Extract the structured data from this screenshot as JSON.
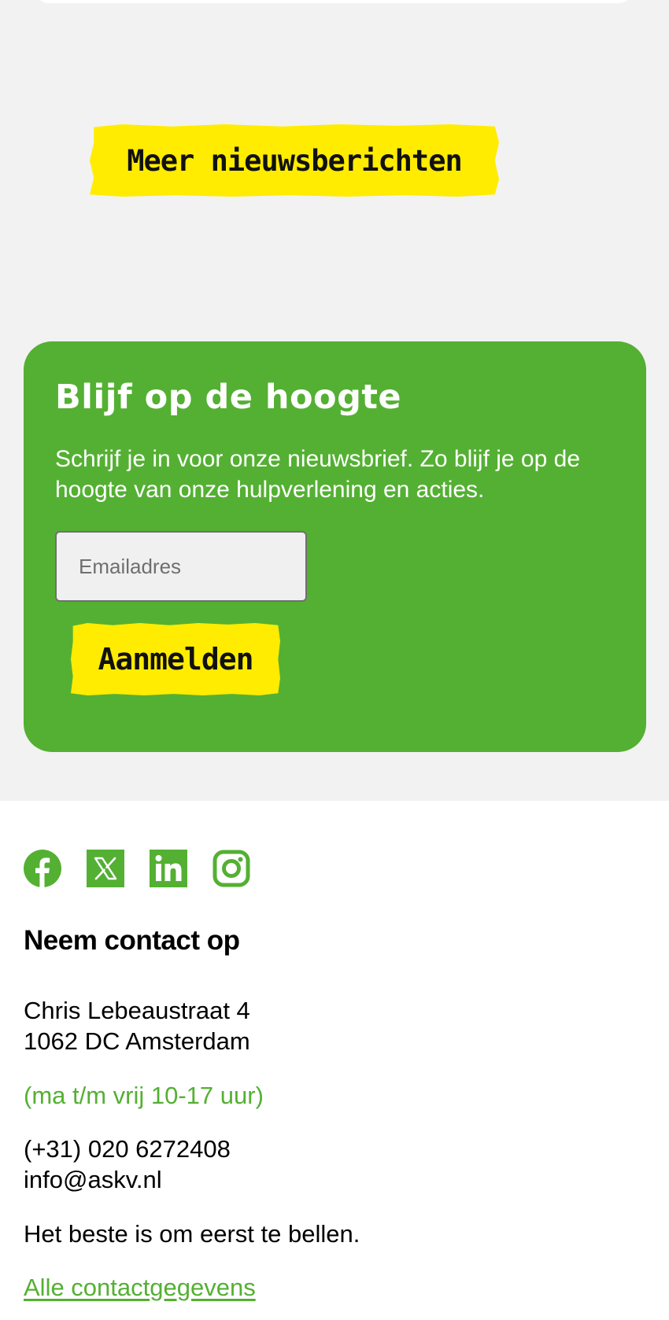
{
  "news": {
    "more_label": "Meer nieuwsberichten"
  },
  "newsletter": {
    "title": "Blijf op de hoogte",
    "text": "Schrijf je in voor onze nieuwsbrief. Zo blijf je op de hoogte van onze hulpverlening en acties.",
    "email_placeholder": "Emailadres",
    "email_value": "",
    "submit_label": "Aanmelden"
  },
  "footer": {
    "social_icons": [
      "facebook-icon",
      "x-icon",
      "linkedin-icon",
      "instagram-icon"
    ],
    "contact_title": "Neem contact op",
    "address_line1": "Chris Lebeaustraat 4",
    "address_line2": "1062 DC Amsterdam",
    "hours": "(ma t/m vrij 10-17 uur)",
    "phone": "(+31) 020 6272408",
    "email": "info@askv.nl",
    "note": "Het beste is om eerst te bellen.",
    "all_contact_link": "Alle contactgegevens"
  },
  "colors": {
    "brand_green": "#54b033",
    "accent_yellow": "#ffec00",
    "section_grey": "#f2f2f2"
  }
}
